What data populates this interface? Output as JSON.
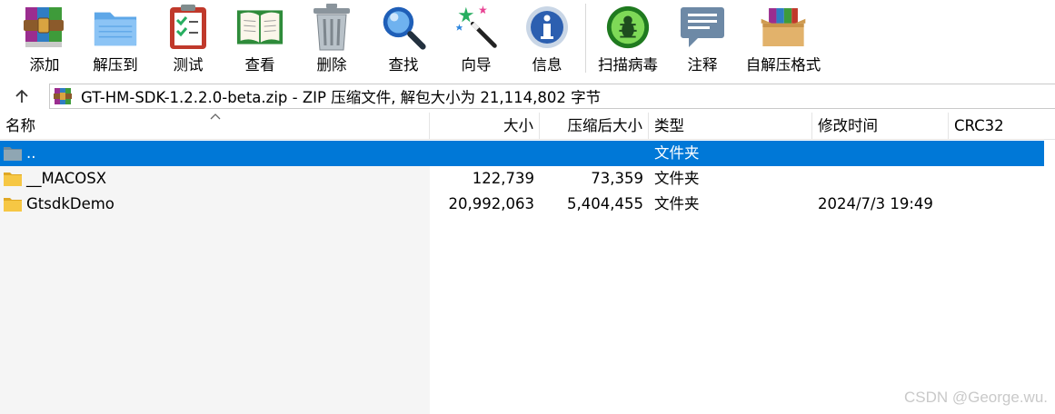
{
  "toolbar": {
    "add": "添加",
    "extract": "解压到",
    "test": "测试",
    "view": "查看",
    "delete": "删除",
    "find": "查找",
    "wizard": "向导",
    "info": "信息",
    "scan": "扫描病毒",
    "comment": "注释",
    "sfx": "自解压格式"
  },
  "address": {
    "path": "GT-HM-SDK-1.2.2.0-beta.zip - ZIP 压缩文件, 解包大小为 21,114,802 字节"
  },
  "columns": {
    "name": "名称",
    "size": "大小",
    "packed": "压缩后大小",
    "type": "类型",
    "modified": "修改时间",
    "crc": "CRC32"
  },
  "rows": [
    {
      "name": "..",
      "size": "",
      "packed": "",
      "type": "文件夹",
      "modified": ""
    },
    {
      "name": "__MACOSX",
      "size": "122,739",
      "packed": "73,359",
      "type": "文件夹",
      "modified": ""
    },
    {
      "name": "GtsdkDemo",
      "size": "20,992,063",
      "packed": "5,404,455",
      "type": "文件夹",
      "modified": "2024/7/3 19:49"
    }
  ],
  "watermark": "CSDN @George.wu.",
  "colors": {
    "selection": "#0078d7",
    "folder": "#f6c744"
  }
}
